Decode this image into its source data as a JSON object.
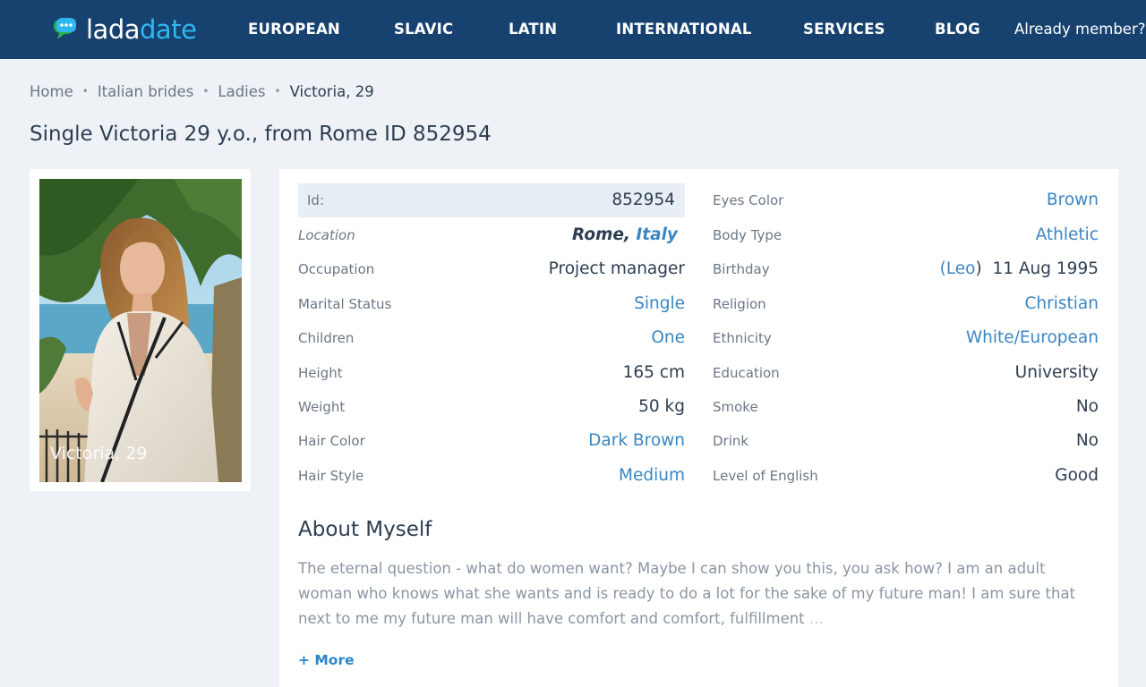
{
  "brand": {
    "part1": "lada",
    "part2": "date"
  },
  "nav": {
    "european": "EUROPEAN",
    "slavic": "SLAVIC",
    "latin": "LATIN",
    "international": "INTERNATIONAL",
    "services": "SERVICES",
    "blog": "BLOG",
    "login": "Already member?"
  },
  "breadcrumb": {
    "home": "Home",
    "italian": "Italian brides",
    "ladies": "Ladies",
    "current": "Victoria, 29"
  },
  "page_title": "Single Victoria 29 y.o., from Rome ID 852954",
  "photo": {
    "caption": "Victoria, 29"
  },
  "profile": {
    "id": {
      "label": "Id:",
      "value": "852954"
    },
    "location": {
      "label": "Location",
      "city": "Rome,",
      "country": "Italy"
    },
    "occupation": {
      "label": "Occupation",
      "value": "Project manager"
    },
    "marital": {
      "label": "Marital Status",
      "value": "Single"
    },
    "children": {
      "label": "Children",
      "value": "One"
    },
    "height": {
      "label": "Height",
      "value": "165 cm"
    },
    "weight": {
      "label": "Weight",
      "value": "50 kg"
    },
    "hair_color": {
      "label": "Hair Color",
      "value": "Dark Brown"
    },
    "hair_style": {
      "label": "Hair Style",
      "value": "Medium"
    },
    "eyes": {
      "label": "Eyes Color",
      "value": "Brown"
    },
    "body": {
      "label": "Body Type",
      "value": "Athletic"
    },
    "birthday": {
      "label": "Birthday",
      "open": "(",
      "sign": "Leo",
      "close": ")",
      "date": "11 Aug 1995"
    },
    "religion": {
      "label": "Religion",
      "value": "Christian"
    },
    "ethnicity": {
      "label": "Ethnicity",
      "value": "White/European"
    },
    "education": {
      "label": "Education",
      "value": "University"
    },
    "smoke": {
      "label": "Smoke",
      "value": "No"
    },
    "drink": {
      "label": "Drink",
      "value": "No"
    },
    "english": {
      "label": "Level of English",
      "value": "Good"
    }
  },
  "about": {
    "title": "About Myself",
    "text": "The eternal question - what do women want? Maybe I can show you this, you ask how? I am an adult woman who knows what she wants and is ready to do a lot for the sake of my future man! I am sure that next to me my future man will have comfort and comfort, fulfillment",
    "ellipsis": "...",
    "more": "+ More"
  },
  "colors": {
    "header": "#17426f",
    "brand_accent": "#2fb7ef",
    "link": "#3a86c3",
    "page_bg": "#eef2f7"
  }
}
